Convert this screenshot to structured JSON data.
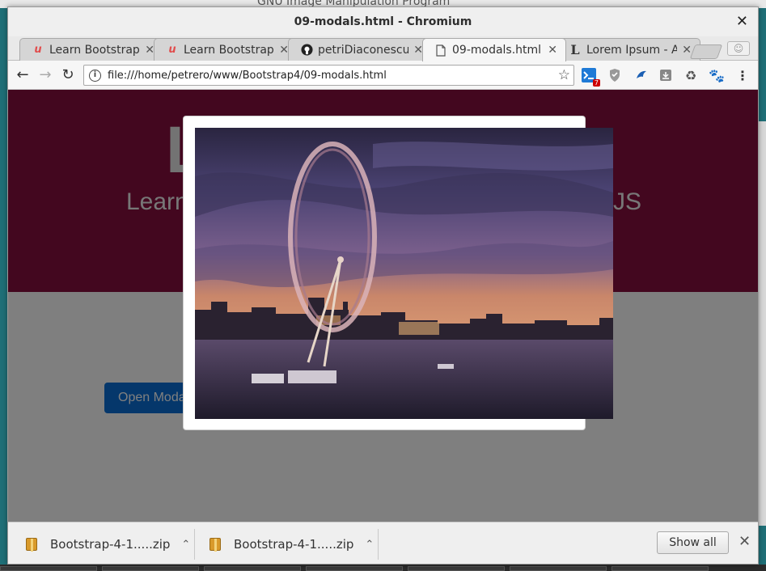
{
  "background": {
    "ghost_title": "GNU Image Manipulation Program"
  },
  "window": {
    "title": "09-modals.html - Chromium",
    "close_icon": "close-icon"
  },
  "tabs": [
    {
      "label": "Learn Bootstrap",
      "favicon": "u",
      "favicon_color": "#e14c4c"
    },
    {
      "label": "Learn Bootstrap",
      "favicon": "u",
      "favicon_color": "#e14c4c"
    },
    {
      "label": "petriDiaconescu",
      "favicon": "github-icon",
      "favicon_color": "#222222"
    },
    {
      "label": "09-modals.html",
      "favicon": "file-icon",
      "favicon_color": "#555555",
      "active": true
    },
    {
      "label": "Lorem Ipsum - All",
      "favicon": "L",
      "favicon_color": "#333333"
    }
  ],
  "toolbar": {
    "url": "file:///home/petrero/www/Bootstrap4/09-modals.html",
    "extension_badge": "7"
  },
  "page": {
    "jumbo_title": "L",
    "jumbo_subtitle": "Learn",
    "jumbo_subtitle_end": "JS",
    "open_modal_label": "Open Modal",
    "jumbo_color": "#870e3f",
    "button_color": "#0a6fd6"
  },
  "modal": {
    "image_description_icon": "london-eye-photo"
  },
  "downloads": {
    "items": [
      {
        "name": "Bootstrap-4-1.....zip"
      },
      {
        "name": "Bootstrap-4-1.....zip"
      }
    ],
    "show_all_label": "Show all"
  }
}
